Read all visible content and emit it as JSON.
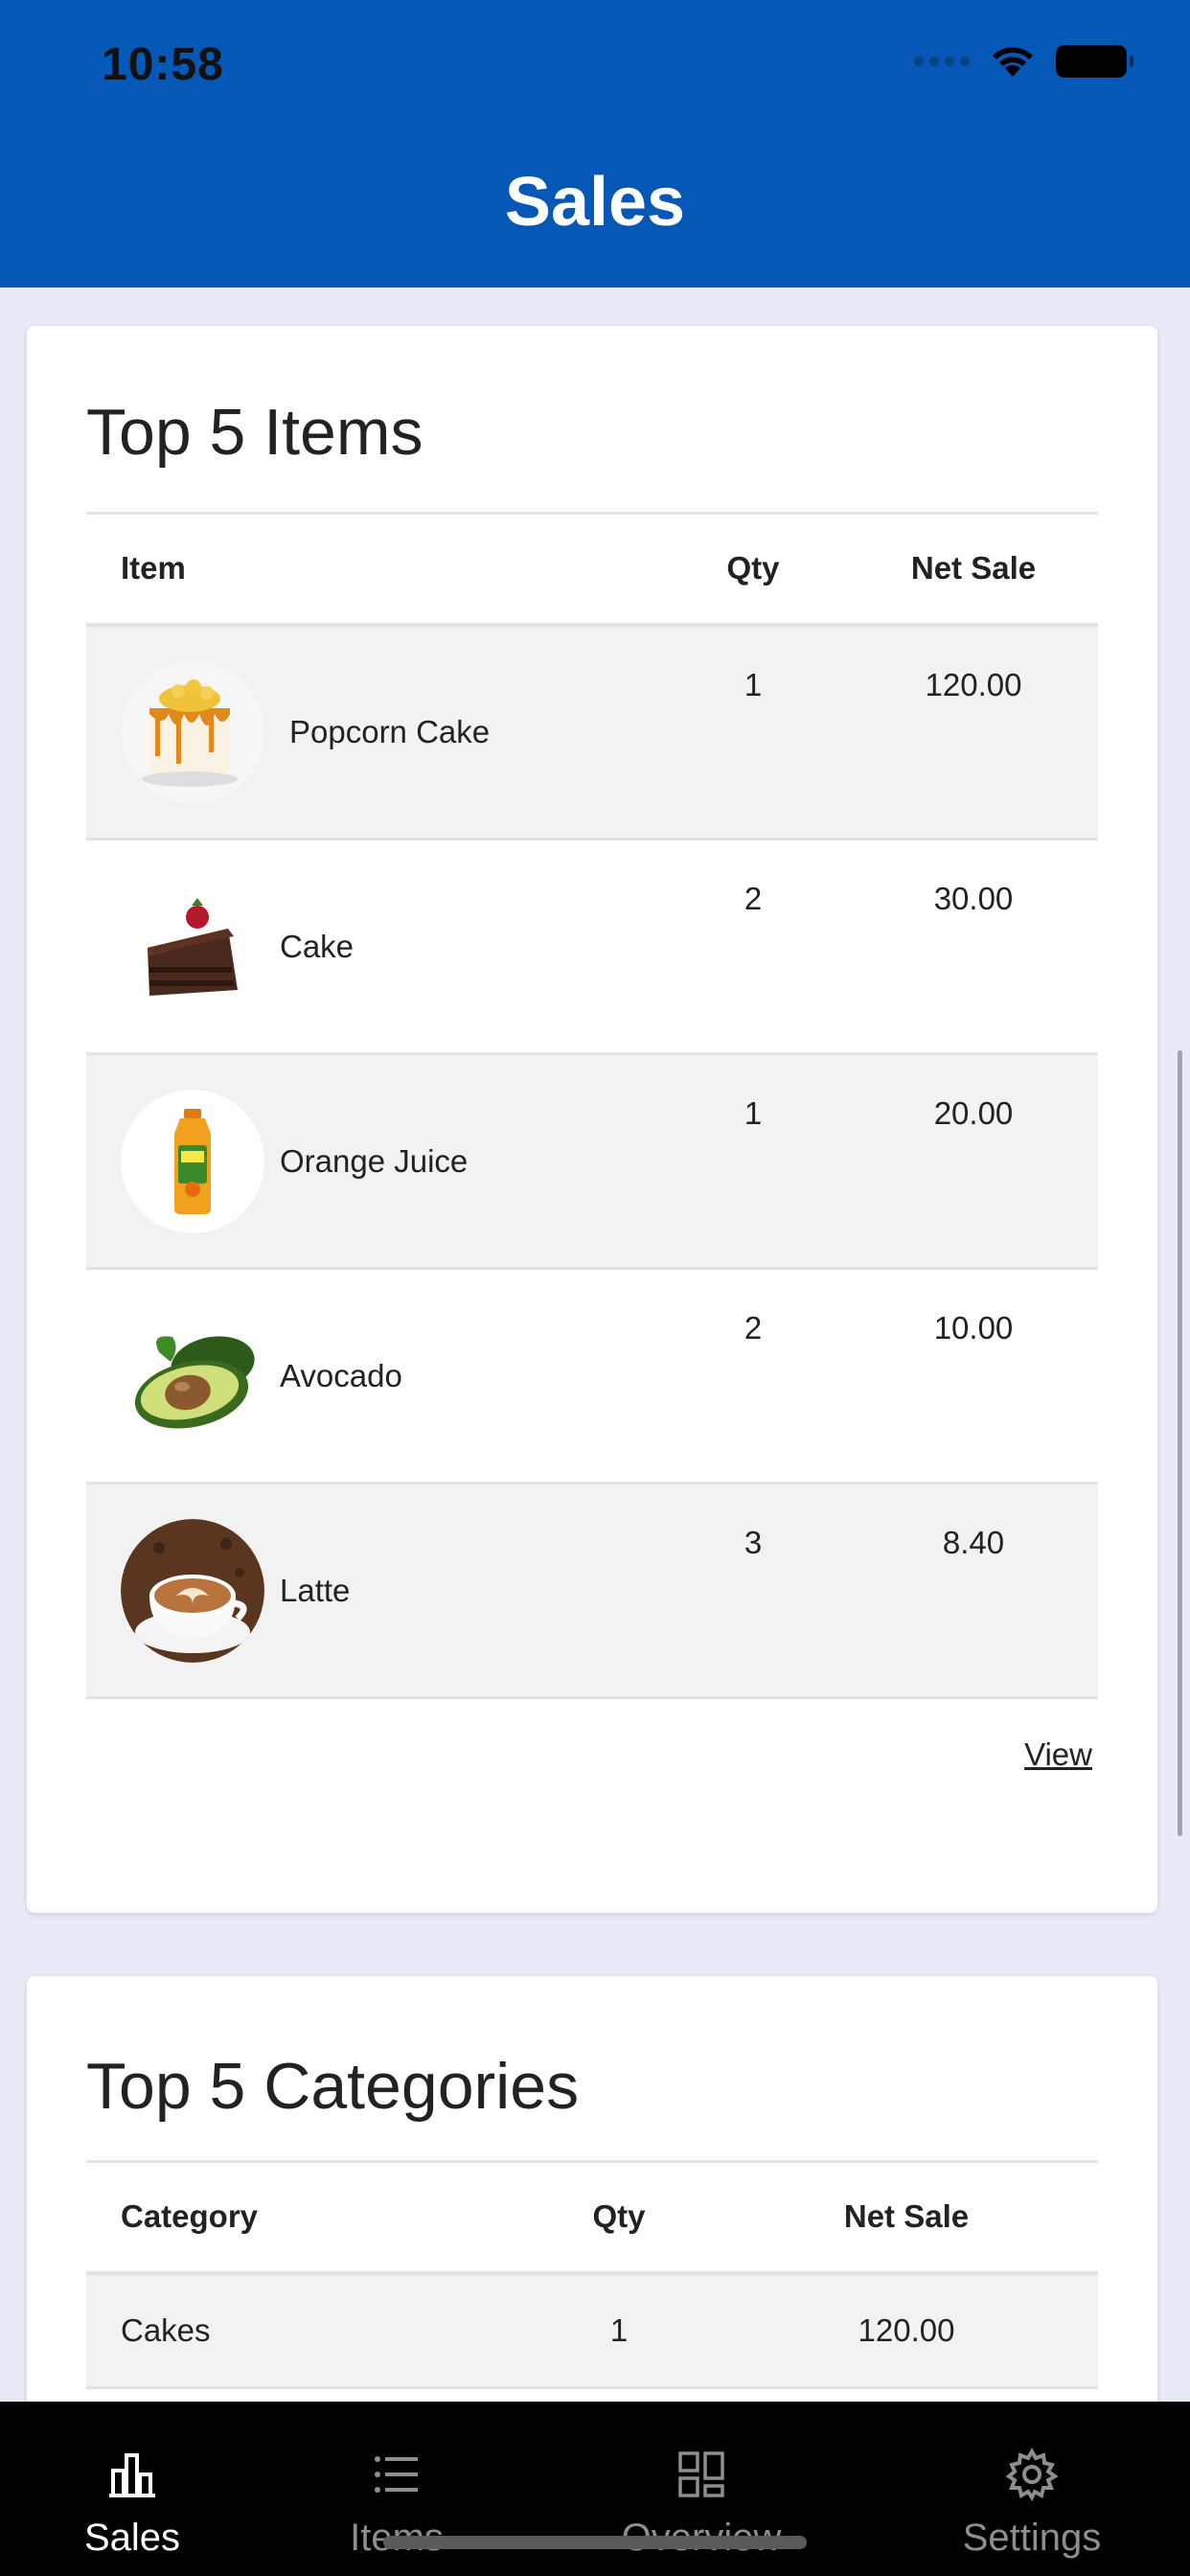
{
  "status_bar": {
    "time": "10:58"
  },
  "header": {
    "title": "Sales"
  },
  "top_items": {
    "title": "Top 5 Items",
    "columns": {
      "item": "Item",
      "qty": "Qty",
      "net_sale": "Net Sale"
    },
    "rows": [
      {
        "name": "Popcorn Cake",
        "qty": "1",
        "net_sale": "120.00",
        "image": "popcorn-cake-image"
      },
      {
        "name": "Cake",
        "qty": "2",
        "net_sale": "30.00",
        "image": "chocolate-cake-image"
      },
      {
        "name": "Orange Juice",
        "qty": "1",
        "net_sale": "20.00",
        "image": "orange-juice-image"
      },
      {
        "name": "Avocado",
        "qty": "2",
        "net_sale": "10.00",
        "image": "avocado-image"
      },
      {
        "name": "Latte",
        "qty": "3",
        "net_sale": "8.40",
        "image": "latte-image"
      }
    ],
    "view_label": "View"
  },
  "top_categories": {
    "title": "Top 5 Categories",
    "columns": {
      "category": "Category",
      "qty": "Qty",
      "net_sale": "Net Sale"
    },
    "rows": [
      {
        "name": "Cakes",
        "qty": "1",
        "net_sale": "120.00"
      }
    ]
  },
  "tab_bar": {
    "tabs": [
      {
        "label": "Sales",
        "icon": "bar-chart-icon",
        "active": true
      },
      {
        "label": "Items",
        "icon": "list-icon",
        "active": false
      },
      {
        "label": "Overview",
        "icon": "grid-icon",
        "active": false
      },
      {
        "label": "Settings",
        "icon": "gear-icon",
        "active": false
      }
    ]
  },
  "colors": {
    "header_blue": "#0558b5",
    "page_background": "#e8eaf8",
    "row_stripe": "#f2f2f2",
    "tab_bar_background": "#000000"
  }
}
